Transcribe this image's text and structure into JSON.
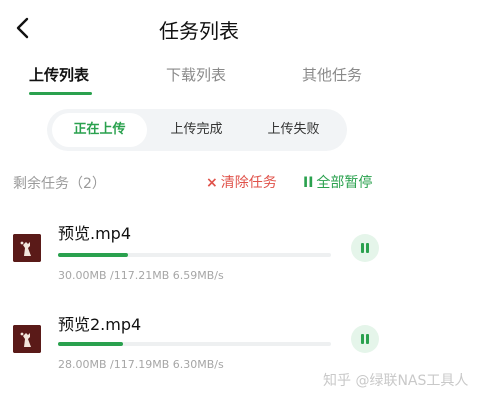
{
  "header": {
    "title": "任务列表",
    "back_icon": "chevron-left-icon"
  },
  "tabs": [
    {
      "label": "上传列表",
      "active": true
    },
    {
      "label": "下载列表",
      "active": false
    },
    {
      "label": "其他任务",
      "active": false
    }
  ],
  "segments": [
    {
      "label": "正在上传",
      "active": true
    },
    {
      "label": "上传完成",
      "active": false
    },
    {
      "label": "上传失败",
      "active": false
    }
  ],
  "toolbar": {
    "remaining": "剩余任务（2）",
    "clear_icon": "×",
    "clear_label": "清除任务",
    "pause_all_icon": "II",
    "pause_all_label": "全部暂停"
  },
  "tasks": [
    {
      "name": "预览.mp4",
      "stats": "30.00MB /117.21MB  6.59MB/s",
      "progress": 0.256
    },
    {
      "name": "预览2.mp4",
      "stats": "28.00MB /117.19MB  6.30MB/s",
      "progress": 0.239
    }
  ],
  "watermark": "知乎 @绿联NAS工具人",
  "colors": {
    "accent": "#2aa14e",
    "danger": "#e0524a",
    "thumb": "#5a1a18"
  }
}
